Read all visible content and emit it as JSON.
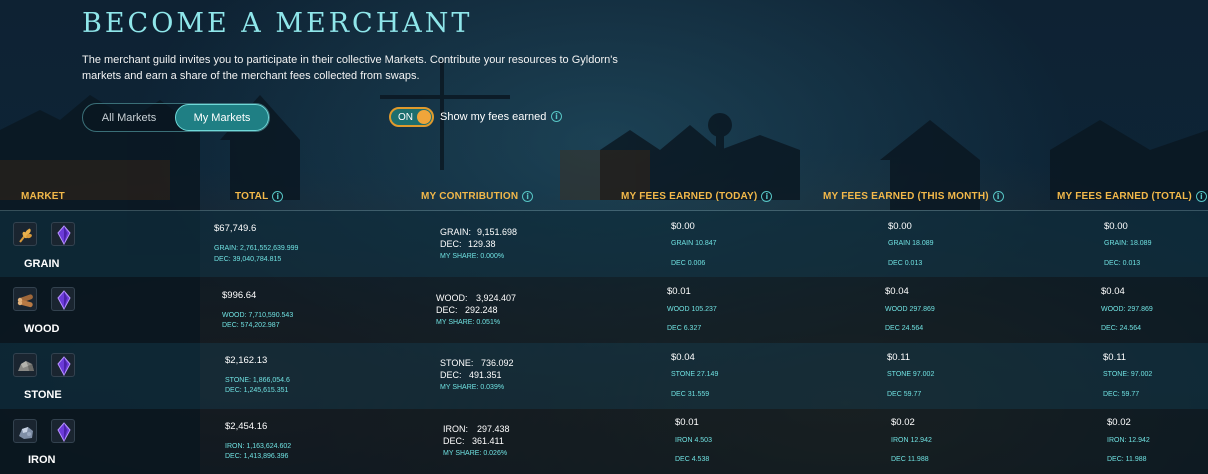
{
  "page": {
    "title": "BECOME A MERCHANT",
    "intro": "The merchant guild invites you to participate in their collective Markets. Contribute your resources to Gyldorn's markets and earn a share of the merchant fees collected from swaps.",
    "tabs": [
      "All Markets",
      "My Markets"
    ],
    "active_tab": "My Markets",
    "toggle": {
      "state": "ON",
      "label": "Show my fees earned"
    }
  },
  "columns": [
    "MARKET",
    "TOTAL",
    "MY CONTRIBUTION",
    "MY FEES EARNED (TODAY)",
    "MY FEES EARNED (THIS MONTH)",
    "MY FEES EARNED (TOTAL)"
  ],
  "rows": [
    {
      "name": "GRAIN",
      "icon": "grain-icon",
      "total": "$67,749.6",
      "total_res": "GRAIN: 2,761,552,639.999",
      "total_dec": "DEC: 39,040,784.815",
      "contrib_res_label": "GRAIN:",
      "contrib_res_val": "9,151.698",
      "contrib_dec_label": "DEC:",
      "contrib_dec_val": "129.38",
      "share": "MY SHARE: 0.000%",
      "today": "$0.00",
      "today_res": "GRAIN 10.847",
      "today_dec": "DEC 0.006",
      "month": "$0.00",
      "month_res": "GRAIN 18.089",
      "month_dec": "DEC 0.013",
      "alltime": "$0.00",
      "alltime_res": "GRAIN: 18.089",
      "alltime_dec": "DEC: 0.013"
    },
    {
      "name": "WOOD",
      "icon": "wood-icon",
      "total": "$996.64",
      "total_res": "WOOD: 7,710,590.543",
      "total_dec": "DEC: 574,202.987",
      "contrib_res_label": "WOOD:",
      "contrib_res_val": "3,924.407",
      "contrib_dec_label": "DEC:",
      "contrib_dec_val": "292.248",
      "share": "MY SHARE: 0.051%",
      "today": "$0.01",
      "today_res": "WOOD 105.237",
      "today_dec": "DEC 6.327",
      "month": "$0.04",
      "month_res": "WOOD 297.869",
      "month_dec": "DEC 24.564",
      "alltime": "$0.04",
      "alltime_res": "WOOD: 297.869",
      "alltime_dec": "DEC: 24.564"
    },
    {
      "name": "STONE",
      "icon": "stone-icon",
      "total": "$2,162.13",
      "total_res": "STONE: 1,866,054.6",
      "total_dec": "DEC: 1,245,615.351",
      "contrib_res_label": "STONE:",
      "contrib_res_val": "736.092",
      "contrib_dec_label": "DEC:",
      "contrib_dec_val": "491.351",
      "share": "MY SHARE: 0.039%",
      "today": "$0.04",
      "today_res": "STONE 27.149",
      "today_dec": "DEC 31.559",
      "month": "$0.11",
      "month_res": "STONE 97.002",
      "month_dec": "DEC 59.77",
      "alltime": "$0.11",
      "alltime_res": "STONE: 97.002",
      "alltime_dec": "DEC: 59.77"
    },
    {
      "name": "IRON",
      "icon": "iron-icon",
      "total": "$2,454.16",
      "total_res": "IRON: 1,163,624.602",
      "total_dec": "DEC: 1,413,896.396",
      "contrib_res_label": "IRON:",
      "contrib_res_val": "297.438",
      "contrib_dec_label": "DEC:",
      "contrib_dec_val": "361.411",
      "share": "MY SHARE: 0.026%",
      "today": "$0.01",
      "today_res": "IRON 4.503",
      "today_dec": "DEC 4.538",
      "month": "$0.02",
      "month_res": "IRON 12.942",
      "month_dec": "DEC 11.988",
      "alltime": "$0.02",
      "alltime_res": "IRON: 12.942",
      "alltime_dec": "DEC: 11.988"
    }
  ]
}
